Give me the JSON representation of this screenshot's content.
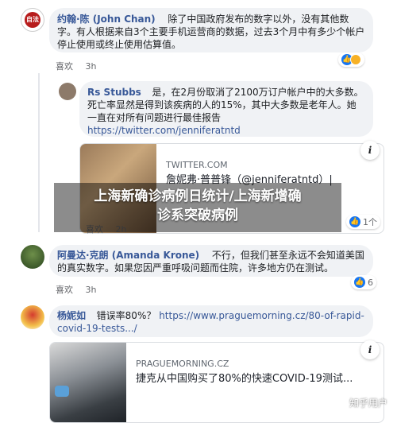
{
  "comments": [
    {
      "avatar_text": "自法",
      "name": "约翰·陈 (John Chan)",
      "text": "除了中国政府发布的数字以外，没有其他数字。有人根据来自3个主要手机运营商的数据，过去3个月中有多少个帐户停止使用或终止使用估算值。",
      "like_label": "喜欢",
      "time": "3h",
      "reaction_count": ""
    },
    {
      "name": "Rs Stubbs",
      "text": "是，在2月份取消了2100万订户帐户中的大多数。死亡率显然是得到该疾病的人的15%，其中大多数是老年人。她一直在对所有问题进行最佳报告",
      "link": "https://twitter.com/jenniferatntd",
      "card_domain": "TWITTER.COM",
      "card_title": "詹妮弗·普普锋（@jenniferatntd）|",
      "like_label": "喜欢",
      "time": "2h",
      "reaction_count": "1个"
    },
    {
      "name": "阿曼达·克朗 (Amanda Krone)",
      "text": "不行，但我们甚至永远不会知道美国的真实数字。如果您因严重呼吸问题而住院，许多地方仍在测试。",
      "like_label": "喜欢",
      "time": "3h",
      "reaction_count": "6"
    },
    {
      "name": "杨妮如",
      "text": "错误率80%？",
      "link": "https://www.praguemorning.cz/80-of-rapid-covid-19-tests.../",
      "card_domain": "PRAGUEMORNING.CZ",
      "card_title": "捷克从中国购买了80%的快速COVID-19测试...",
      "like_label": "",
      "time": "",
      "reaction_count": ""
    }
  ],
  "overlay": {
    "line1": "上海新确诊病例日统计/上海新增确",
    "line2": "诊系突破病例"
  },
  "watermark": "知乎用户",
  "info_glyph": "i",
  "colors": {
    "name": "#385898",
    "bubble": "#f0f2f5",
    "like": "#1877f2",
    "wow": "#f7b125"
  }
}
